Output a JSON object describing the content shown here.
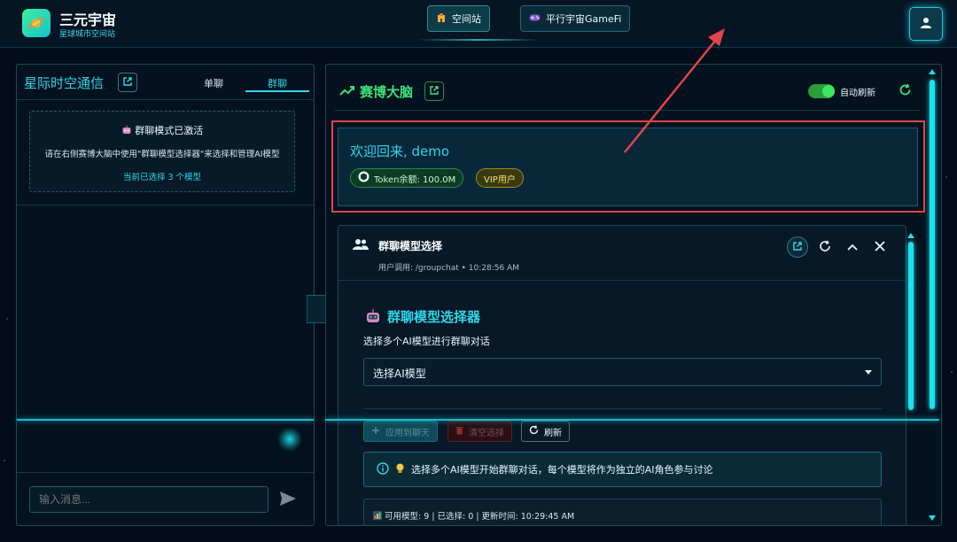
{
  "header": {
    "app_title": "三元宇宙",
    "app_subtitle": "星球城市空间站",
    "nav": [
      {
        "label": "空间站",
        "icon": "building-icon"
      },
      {
        "label": "平行宇宙GameFi",
        "icon": "gamepad-icon"
      }
    ],
    "user_icon": "user-icon"
  },
  "left_panel": {
    "title": "星际时空通信",
    "tabs": [
      {
        "label": "单聊",
        "active": false
      },
      {
        "label": "群聊",
        "active": true
      }
    ],
    "notice": {
      "title": "群聊模式已激活",
      "text": "请在右侧赛博大脑中使用\"群聊模型选择器\"来选择和管理AI模型",
      "count": "当前已选择 3 个模型"
    },
    "input": {
      "placeholder": "输入消息..."
    }
  },
  "right_panel": {
    "title": "赛博大脑",
    "auto_refresh_label": "自动刷新",
    "auto_refresh_on": true,
    "welcome": {
      "text": "欢迎回来, demo",
      "token_badge": "Token余额: 100.0M",
      "vip_badge": "VIP用户"
    },
    "group_chat": {
      "title": "群聊模型选择",
      "meta": "用户调用: /groupchat • 10:28:56 AM",
      "body_title": "群聊模型选择器",
      "body_desc": "选择多个AI模型进行群聊对话",
      "select_value": "选择AI模型",
      "buttons": {
        "apply": "应用到聊天",
        "clear": "清空选择",
        "refresh": "刷新"
      },
      "info": "选择多个AI模型开始群聊对话，每个模型将作为独立的AI角色参与讨论",
      "stats": "可用模型: 9 | 已选择: 0 | 更新时间: 10:29:45 AM"
    }
  },
  "colors": {
    "accent_cyan": "#2fd6ea",
    "accent_green": "#3de07a",
    "highlight_red": "#e0454a"
  }
}
